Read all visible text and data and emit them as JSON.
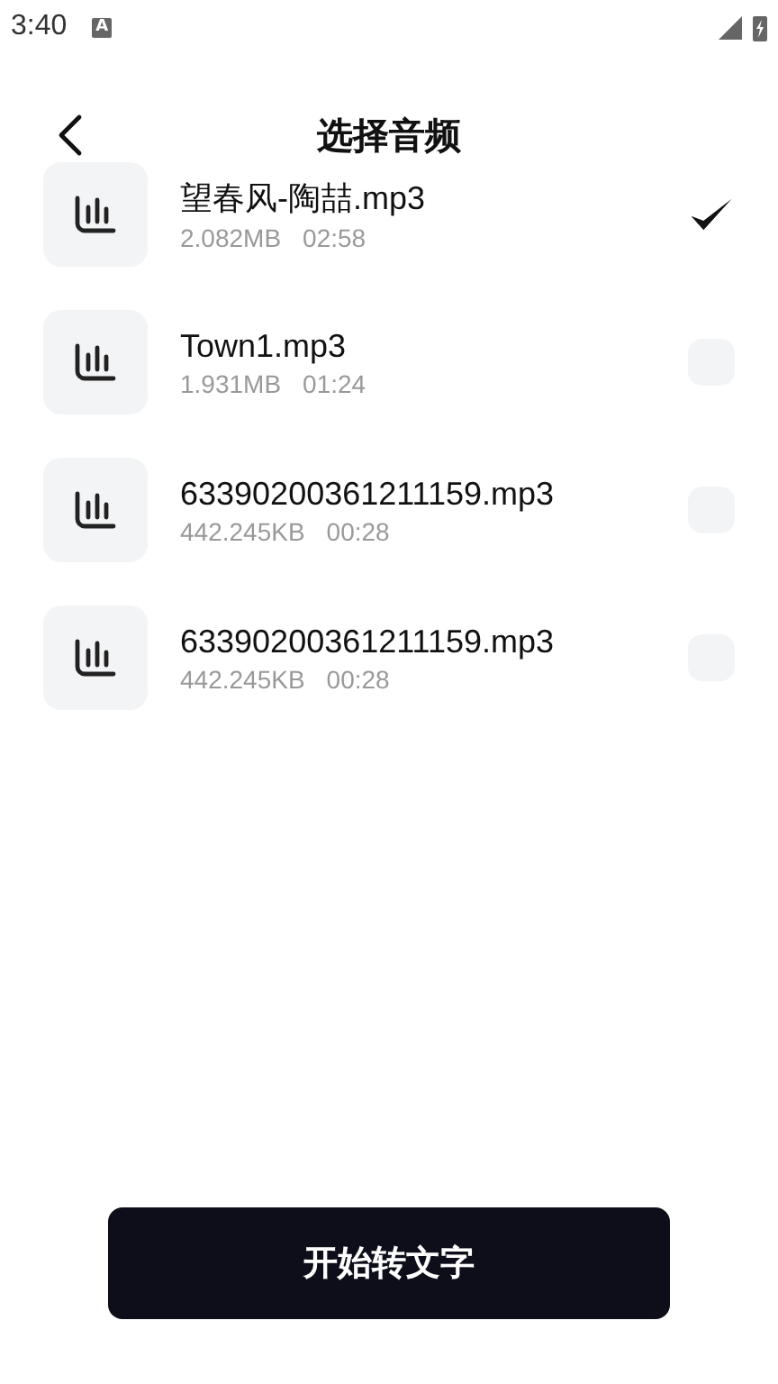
{
  "status_bar": {
    "time": "3:40",
    "notification_icon": "A"
  },
  "header": {
    "title": "选择音频"
  },
  "files": [
    {
      "name": "望春风-陶喆.mp3",
      "size": "2.082MB",
      "duration": "02:58",
      "selected": true
    },
    {
      "name": "Town1.mp3",
      "size": "1.931MB",
      "duration": "01:24",
      "selected": false
    },
    {
      "name": "63390200361211159.mp3",
      "size": "442.245KB",
      "duration": "00:28",
      "selected": false
    },
    {
      "name": "63390200361211159.mp3",
      "size": "442.245KB",
      "duration": "00:28",
      "selected": false
    }
  ],
  "action_button": "开始转文字"
}
